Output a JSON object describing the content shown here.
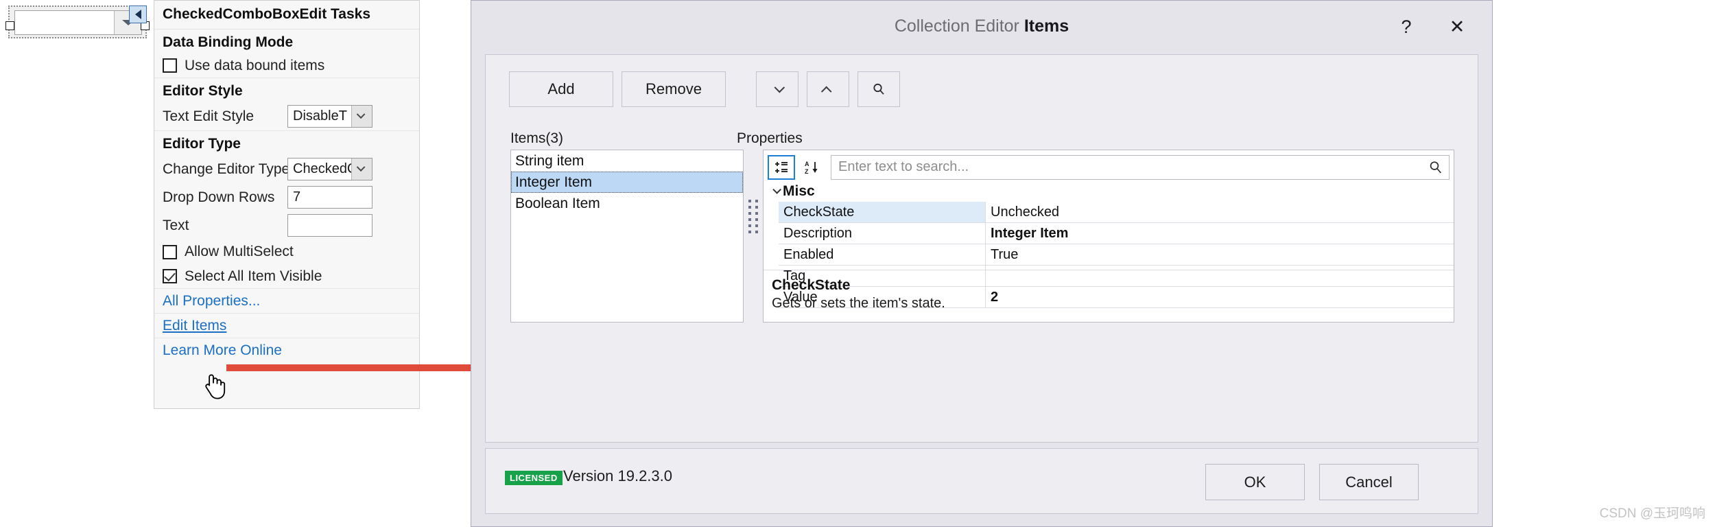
{
  "designer": {
    "combo_value": "",
    "smart_tag_icon": "triangle-left-icon",
    "dropdown_icon": "triangle-down-icon"
  },
  "tasks_panel": {
    "title": "CheckedComboBoxEdit Tasks",
    "groups": [
      {
        "heading": "Data Binding Mode"
      },
      {
        "heading": "Editor Style"
      },
      {
        "heading": "Editor Type"
      }
    ],
    "use_data_bound_items": {
      "label": "Use data bound items",
      "checked": false
    },
    "text_edit_style": {
      "label": "Text Edit Style",
      "value": "DisableT"
    },
    "change_editor_type": {
      "label": "Change Editor Type",
      "value": "CheckedC"
    },
    "drop_down_rows": {
      "label": "Drop Down Rows",
      "value": "7"
    },
    "text_field": {
      "label": "Text",
      "value": ""
    },
    "allow_multiselect": {
      "label": "Allow MultiSelect",
      "checked": false
    },
    "select_all_item_visible": {
      "label": "Select All Item Visible",
      "checked": true
    },
    "links": {
      "all_properties": "All Properties...",
      "edit_items": "Edit Items",
      "learn_more": "Learn More Online"
    }
  },
  "annotation": {
    "arrow_color": "#e14b3c"
  },
  "dialog": {
    "title_prefix": "Collection Editor",
    "title_suffix": "Items",
    "help_glyph": "?",
    "close_glyph": "✕",
    "toolbar": {
      "add": "Add",
      "remove": "Remove",
      "move_down_icon": "chevron-down-icon",
      "move_up_icon": "chevron-up-icon",
      "search_icon": "search-icon"
    },
    "items_label": "Items(3)",
    "properties_label": "Properties",
    "items": [
      {
        "label": "String item",
        "selected": false
      },
      {
        "label": "Integer Item",
        "selected": true
      },
      {
        "label": "Boolean Item",
        "selected": false
      }
    ],
    "props_toolbar": {
      "categorized_icon": "categorized-list-icon",
      "alphabetical_icon": "sort-az-icon",
      "search_icon": "search-icon"
    },
    "search": {
      "value": "",
      "placeholder": "Enter text to search..."
    },
    "grid": {
      "category": "Misc",
      "rows": [
        {
          "key": "CheckState",
          "value": "Unchecked",
          "selected": true,
          "bold_value": false
        },
        {
          "key": "Description",
          "value": "Integer Item",
          "selected": false,
          "bold_value": true
        },
        {
          "key": "Enabled",
          "value": "True",
          "selected": false,
          "bold_value": false
        },
        {
          "key": "Tag",
          "value": "",
          "selected": false,
          "bold_value": false
        },
        {
          "key": "Value",
          "value": "2",
          "selected": false,
          "bold_value": true
        }
      ]
    },
    "description": {
      "title": "CheckState",
      "text": "Gets or sets the item's state."
    },
    "footer": {
      "license_badge": "LICENSED",
      "version": "Version 19.2.3.0",
      "ok": "OK",
      "cancel": "Cancel"
    }
  },
  "watermark": "CSDN @玉珂鸣响"
}
